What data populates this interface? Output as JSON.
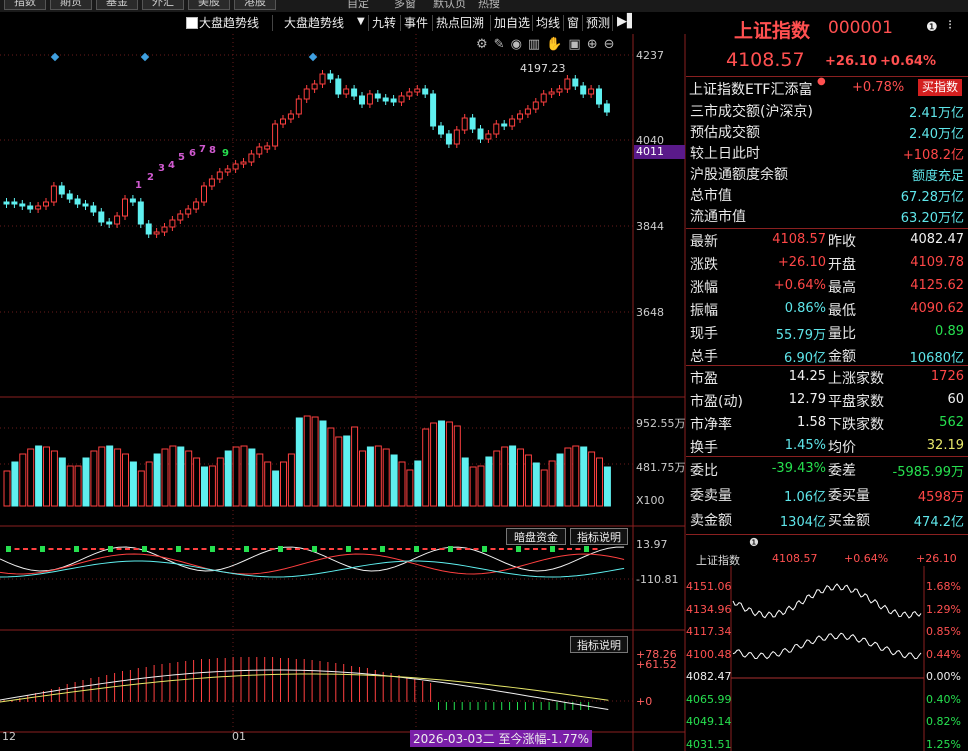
{
  "top_nav": {
    "buttons": [
      "指数",
      "期货",
      "基金",
      "外汇",
      "美股",
      "港股"
    ],
    "links": [
      "自定",
      "多窗",
      "默认页",
      "热搜"
    ]
  },
  "toolbar": {
    "checkbox_label": "大盘趋势线",
    "dropdown_label": "大盘趋势线",
    "items": [
      "九转",
      "事件",
      "热点回溯",
      "加自选",
      "均线",
      "窗",
      "预测"
    ]
  },
  "chart": {
    "price_axis": [
      "4237",
      "4040",
      "3844",
      "3648"
    ],
    "current_price_tag": "4011",
    "high_label": "4197.23",
    "td_numbers": [
      "1",
      "2",
      "3",
      "4",
      "5",
      "6",
      "7",
      "8",
      "9"
    ],
    "volume_axis": [
      "952.55万",
      "481.75万",
      "X100"
    ],
    "macd_axis": [
      "13.97",
      "-110.81"
    ],
    "macd_button": "暗盘资金",
    "indicator_button": "指标说明",
    "sub_axis": [
      "+78.26",
      "+61.52",
      "+0"
    ],
    "sub_indicator_button": "指标说明",
    "date_labels": [
      "12",
      "01"
    ],
    "cursor_label": "2026-03-03二 至今涨幅-1.77%"
  },
  "quote": {
    "title": "上证指数",
    "code": "000001",
    "price": "4108.57",
    "change": "+26.10",
    "change_pct": "+0.64%",
    "etf_name": "上证指数ETF汇添富",
    "etf_pct": "+0.78%",
    "buy_button": "买指数",
    "summary": [
      {
        "label": "三市成交额(沪深京)",
        "value": "2.41万亿",
        "color": "cyan"
      },
      {
        "label": "预估成交额",
        "value": "2.40万亿",
        "color": "cyan"
      },
      {
        "label": "较上日此时",
        "value": "+108.2亿",
        "color": "red"
      },
      {
        "label": "沪股通额度余额",
        "value": "额度充足",
        "color": "cyan"
      },
      {
        "label": "总市值",
        "value": "67.28万亿",
        "color": "cyan"
      },
      {
        "label": "流通市值",
        "value": "63.20万亿",
        "color": "cyan"
      }
    ],
    "pairs": [
      {
        "l1": "最新",
        "v1": "4108.57",
        "c1": "red",
        "l2": "昨收",
        "v2": "4082.47",
        "c2": "wht"
      },
      {
        "l1": "涨跌",
        "v1": "+26.10",
        "c1": "red",
        "l2": "开盘",
        "v2": "4109.78",
        "c2": "red"
      },
      {
        "l1": "涨幅",
        "v1": "+0.64%",
        "c1": "red",
        "l2": "最高",
        "v2": "4125.62",
        "c2": "red"
      },
      {
        "l1": "振幅",
        "v1": "0.86%",
        "c1": "cyan",
        "l2": "最低",
        "v2": "4090.62",
        "c2": "red"
      },
      {
        "l1": "现手",
        "v1": "55.79万",
        "c1": "cyan",
        "l2": "量比",
        "v2": "0.89",
        "c2": "grn"
      },
      {
        "l1": "总手",
        "v1": "6.90亿",
        "c1": "cyan",
        "l2": "金额",
        "v2": "10680亿",
        "c2": "cyan"
      }
    ],
    "pairs2": [
      {
        "l1": "市盈",
        "v1": "14.25",
        "c1": "wht",
        "l2": "上涨家数",
        "v2": "1726",
        "c2": "red"
      },
      {
        "l1": "市盈(动)",
        "v1": "12.79",
        "c1": "wht",
        "l2": "平盘家数",
        "v2": "60",
        "c2": "wht"
      },
      {
        "l1": "市净率",
        "v1": "1.58",
        "c1": "wht",
        "l2": "下跌家数",
        "v2": "562",
        "c2": "grn"
      },
      {
        "l1": "换手",
        "v1": "1.45%",
        "c1": "cyan",
        "l2": "均价",
        "v2": "32.19",
        "c2": "yel"
      }
    ],
    "pairs3": [
      {
        "l1": "委比",
        "v1": "-39.43%",
        "c1": "grn",
        "l2": "委差",
        "v2": "-5985.99万",
        "c2": "grn"
      },
      {
        "l1": "委卖量",
        "v1": "1.06亿",
        "c1": "cyan",
        "l2": "委买量",
        "v2": "4598万",
        "c2": "red"
      },
      {
        "l1": "卖金额",
        "v1": "1304亿",
        "c1": "cyan",
        "l2": "买金额",
        "v2": "474.2亿",
        "c2": "cyan"
      }
    ]
  },
  "mini_chart": {
    "name": "上证指数",
    "price": "4108.57",
    "pct": "+0.64%",
    "chg": "+26.10",
    "left_axis": [
      "4151.06",
      "4134.96",
      "4117.34",
      "4100.48",
      "4082.47",
      "4065.99",
      "4049.14",
      "4031.51"
    ],
    "right_axis": [
      "1.68%",
      "1.29%",
      "0.85%",
      "0.44%",
      "0.00%",
      "0.40%",
      "0.82%",
      "1.25%"
    ]
  }
}
